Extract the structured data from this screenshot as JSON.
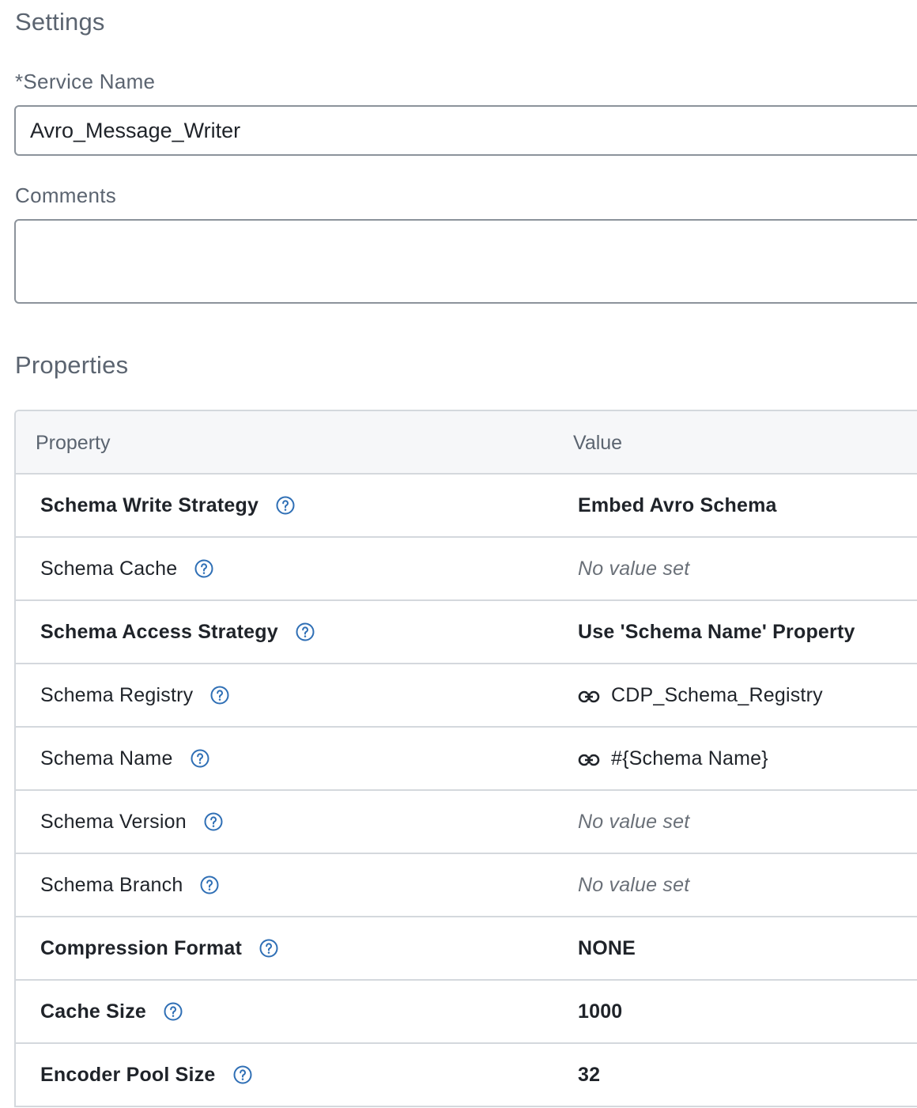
{
  "settings": {
    "title": "Settings",
    "service_name_label": "*Service Name",
    "service_name_value": "Avro_Message_Writer",
    "comments_label": "Comments",
    "comments_value": ""
  },
  "properties": {
    "title": "Properties",
    "columns": {
      "property": "Property",
      "value": "Value"
    },
    "rows": [
      {
        "name": "Schema Write Strategy",
        "required": true,
        "value": "Embed Avro Schema",
        "value_kind": "set",
        "help_icon": "help-circle-icon"
      },
      {
        "name": "Schema Cache",
        "required": false,
        "value": "No value set",
        "value_kind": "empty",
        "help_icon": "help-circle-icon"
      },
      {
        "name": "Schema Access Strategy",
        "required": true,
        "value": "Use 'Schema Name' Property",
        "value_kind": "set",
        "help_icon": "help-circle-icon"
      },
      {
        "name": "Schema Registry",
        "required": false,
        "value": "CDP_Schema_Registry",
        "value_kind": "link",
        "help_icon": "help-circle-icon",
        "value_icon": "link-icon"
      },
      {
        "name": "Schema Name",
        "required": false,
        "value": "#{Schema Name}",
        "value_kind": "link",
        "help_icon": "help-circle-icon",
        "value_icon": "link-icon"
      },
      {
        "name": "Schema Version",
        "required": false,
        "value": "No value set",
        "value_kind": "empty",
        "help_icon": "help-circle-icon"
      },
      {
        "name": "Schema Branch",
        "required": false,
        "value": "No value set",
        "value_kind": "empty",
        "help_icon": "help-circle-icon"
      },
      {
        "name": "Compression Format",
        "required": true,
        "value": "NONE",
        "value_kind": "set",
        "help_icon": "help-circle-icon"
      },
      {
        "name": "Cache Size",
        "required": true,
        "value": "1000",
        "value_kind": "set",
        "help_icon": "help-circle-icon"
      },
      {
        "name": "Encoder Pool Size",
        "required": true,
        "value": "32",
        "value_kind": "set",
        "help_icon": "help-circle-icon"
      }
    ]
  },
  "colors": {
    "accent": "#2f6fb5",
    "label": "#5b6470",
    "border": "#d4d8dd"
  }
}
